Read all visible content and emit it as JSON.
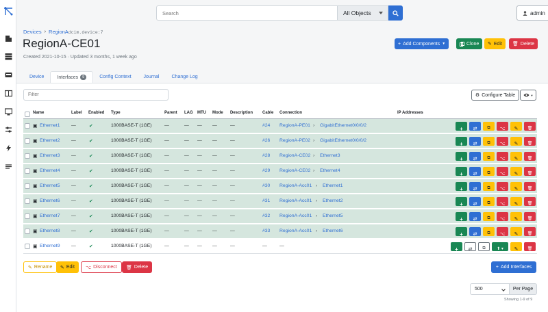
{
  "topbar": {
    "search_placeholder": "Search",
    "object_filter": "All Objects",
    "user": "admin"
  },
  "breadcrumb": {
    "root": "Devices",
    "site": "RegionA",
    "suffix": "dcim.device:7"
  },
  "device": {
    "name": "RegionA-CE01",
    "created": "Created 2021-10-15 · Updated 3 months, 1 week ago"
  },
  "actions": {
    "add_components": "Add Components",
    "clone": "Clone",
    "edit": "Edit",
    "delete": "Delete"
  },
  "tabs": [
    {
      "label": "Device"
    },
    {
      "label": "Interfaces",
      "count": "9"
    },
    {
      "label": "Config Context"
    },
    {
      "label": "Journal"
    },
    {
      "label": "Change Log"
    }
  ],
  "table": {
    "filter_placeholder": "Filter",
    "configure_label": "Configure Table",
    "columns": [
      "Name",
      "Label",
      "Enabled",
      "Type",
      "Parent",
      "LAG",
      "MTU",
      "Mode",
      "Description",
      "Cable",
      "Connection",
      "IP Addresses"
    ],
    "rows": [
      {
        "name": "Ethernet1",
        "label": "—",
        "type": "1000BASE-T (1GE)",
        "parent": "—",
        "lag": "—",
        "mtu": "—",
        "mode": "—",
        "description": "—",
        "cable": "#24",
        "peer_device": "RegionA-PE01",
        "peer_iface": "GigabitEthernet0/0/0/2"
      },
      {
        "name": "Ethernet2",
        "label": "—",
        "type": "1000BASE-T (1GE)",
        "parent": "—",
        "lag": "—",
        "mtu": "—",
        "mode": "—",
        "description": "—",
        "cable": "#26",
        "peer_device": "RegionA-PE02",
        "peer_iface": "GigabitEthernet0/0/0/2"
      },
      {
        "name": "Ethernet3",
        "label": "—",
        "type": "1000BASE-T (1GE)",
        "parent": "—",
        "lag": "—",
        "mtu": "—",
        "mode": "—",
        "description": "—",
        "cable": "#28",
        "peer_device": "RegionA-CE02",
        "peer_iface": "Ethernet3"
      },
      {
        "name": "Ethernet4",
        "label": "—",
        "type": "1000BASE-T (1GE)",
        "parent": "—",
        "lag": "—",
        "mtu": "—",
        "mode": "—",
        "description": "—",
        "cable": "#29",
        "peer_device": "RegionA-CE02",
        "peer_iface": "Ethernet4"
      },
      {
        "name": "Ethernet5",
        "label": "—",
        "type": "1000BASE-T (1GE)",
        "parent": "—",
        "lag": "—",
        "mtu": "—",
        "mode": "—",
        "description": "—",
        "cable": "#30",
        "peer_device": "RegionA-Acc01",
        "peer_iface": "Ethernet1"
      },
      {
        "name": "Ethernet6",
        "label": "—",
        "type": "1000BASE-T (1GE)",
        "parent": "—",
        "lag": "—",
        "mtu": "—",
        "mode": "—",
        "description": "—",
        "cable": "#31",
        "peer_device": "RegionA-Acc01",
        "peer_iface": "Ethernet2"
      },
      {
        "name": "Ethernet7",
        "label": "—",
        "type": "1000BASE-T (1GE)",
        "parent": "—",
        "lag": "—",
        "mtu": "—",
        "mode": "—",
        "description": "—",
        "cable": "#32",
        "peer_device": "RegionA-Acc01",
        "peer_iface": "Ethernet5"
      },
      {
        "name": "Ethernet8",
        "label": "—",
        "type": "1000BASE-T (1GE)",
        "parent": "—",
        "lag": "—",
        "mtu": "—",
        "mode": "—",
        "description": "—",
        "cable": "#33",
        "peer_device": "RegionA-Acc01",
        "peer_iface": "Ethernet6"
      },
      {
        "name": "Ethernet9",
        "label": "—",
        "type": "1000BASE-T (1GE)",
        "parent": "—",
        "lag": "—",
        "mtu": "—",
        "mode": "—",
        "description": "—",
        "cable": "—",
        "connection": "—"
      }
    ]
  },
  "bulk": {
    "rename": "Rename",
    "edit": "Edit",
    "disconnect": "Disconnect",
    "delete": "Delete",
    "add_interfaces": "Add Interfaces"
  },
  "pagination": {
    "per_page_value": "500",
    "per_page_label": "Per Page",
    "showing": "Showing 1-9 of 9"
  },
  "colors": {
    "primary": "#2f6fd3",
    "success": "#198754",
    "warning": "#ffc107",
    "danger": "#dc3545",
    "connected_row": "#d5e6de"
  }
}
